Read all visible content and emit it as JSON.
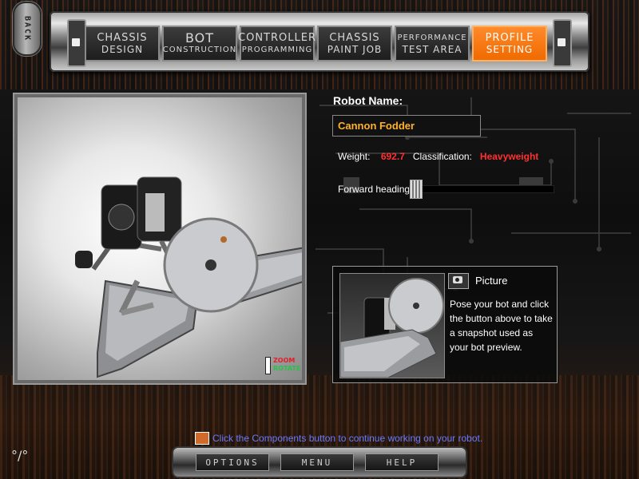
{
  "nav": {
    "back_label": "BACK",
    "tabs": [
      {
        "line1": "CHASSIS",
        "line2": "DESIGN"
      },
      {
        "line1": "BOT",
        "line2": "CONSTRUCTION"
      },
      {
        "line1": "CONTROLLER",
        "line2": "PROGRAMMING"
      },
      {
        "line1": "CHASSIS",
        "line2": "PAINT JOB"
      },
      {
        "line1": "PERFORMANCE",
        "line2": "TEST AREA"
      },
      {
        "line1": "PROFILE",
        "line2": "SETTING"
      }
    ],
    "active_tab": "PROFILE SETTING"
  },
  "viewport": {
    "zoom_label": "ZOOM",
    "rotate_label": "ROTATE"
  },
  "profile": {
    "robot_name_label": "Robot Name:",
    "robot_name_value": "Cannon Fodder",
    "weight_label": "Weight:",
    "weight_value": "692.7",
    "classification_label": "Classification:",
    "classification_value": "Heavyweight",
    "heading_label": "Forward heading:",
    "heading_position": 0.0
  },
  "picture": {
    "title": "Picture",
    "text": "Pose your bot and click the button above to take a snapshot used as your bot preview."
  },
  "footer": {
    "hint": "Click the Components button to continue working on your robot.",
    "options_label": "OPTIONS",
    "menu_label": "MENU",
    "help_label": "HELP"
  },
  "colors": {
    "accent": "#f06a00",
    "name_text": "#ffb22a",
    "stat_value": "#ff3030",
    "hint_text": "#6a7aff"
  }
}
